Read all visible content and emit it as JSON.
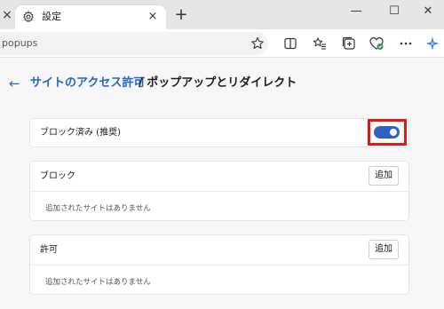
{
  "titlebar": {
    "tab_title": "設定",
    "prev_tab_close": "×",
    "tab_close": "×",
    "new_tab": "+",
    "minimize": "—",
    "maximize": "☐",
    "close": "✕"
  },
  "toolbar": {
    "address_text": "popups"
  },
  "page": {
    "back_arrow": "←",
    "breadcrumb_link": "サイトのアクセス許可",
    "breadcrumb_rest": "/ ポップアップとリダイレクト"
  },
  "blocked_setting": {
    "label": "ブロック済み (推奨)",
    "toggle_on": true
  },
  "block_section": {
    "label": "ブロック",
    "add_button": "追加",
    "empty_text": "追加されたサイトはありません"
  },
  "allow_section": {
    "label": "許可",
    "add_button": "追加",
    "empty_text": "追加されたサイトはありません"
  },
  "colors": {
    "accent": "#2466c9",
    "toggle": "#2f62c2",
    "highlight": "#e01818"
  }
}
